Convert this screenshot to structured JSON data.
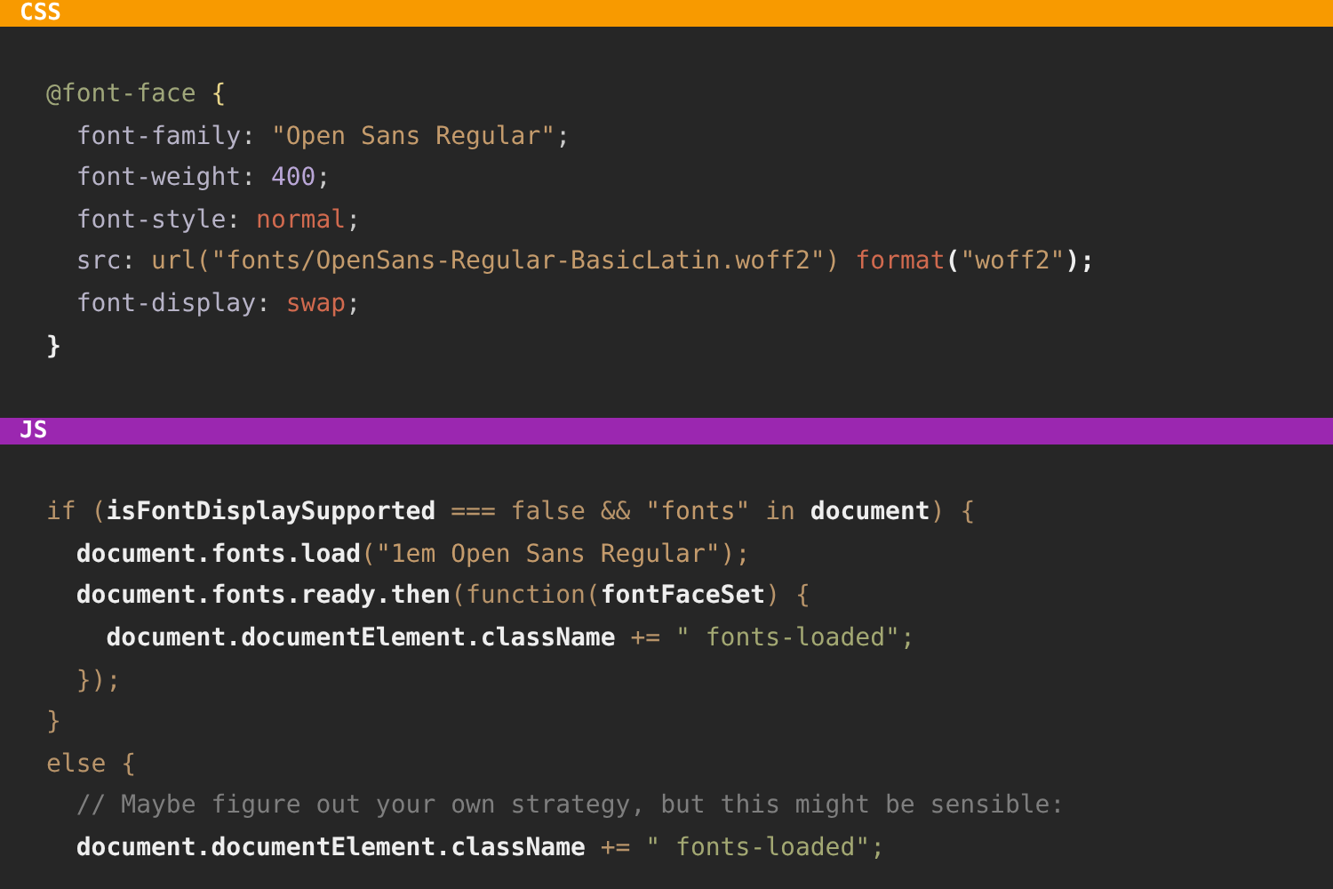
{
  "sections": [
    {
      "label": "CSS",
      "color": "#f89a00",
      "lines": [
        [
          {
            "text": "@font-face ",
            "kind": "at"
          },
          {
            "text": "{",
            "kind": "brace"
          }
        ],
        [
          {
            "text": "  font-family",
            "kind": "prop"
          },
          {
            "text": ": ",
            "kind": "plain"
          },
          {
            "text": "\"Open Sans Regular\"",
            "kind": "string"
          },
          {
            "text": ";",
            "kind": "plain"
          }
        ],
        [
          {
            "text": "  font-weight",
            "kind": "prop"
          },
          {
            "text": ": ",
            "kind": "plain"
          },
          {
            "text": "400",
            "kind": "number"
          },
          {
            "text": ";",
            "kind": "plain"
          }
        ],
        [
          {
            "text": "  font-style",
            "kind": "prop"
          },
          {
            "text": ": ",
            "kind": "plain"
          },
          {
            "text": "normal",
            "kind": "literal"
          },
          {
            "text": ";",
            "kind": "plain"
          }
        ],
        [
          {
            "text": "  src",
            "kind": "prop"
          },
          {
            "text": ": ",
            "kind": "plain"
          },
          {
            "text": "url(\"fonts/OpenSans-Regular-BasicLatin.woff2\")",
            "kind": "string"
          },
          {
            "text": " format",
            "kind": "literal"
          },
          {
            "text": "(",
            "kind": "ident"
          },
          {
            "text": "\"woff2\"",
            "kind": "string"
          },
          {
            "text": ");",
            "kind": "ident"
          }
        ],
        [
          {
            "text": "  font-display",
            "kind": "prop"
          },
          {
            "text": ": ",
            "kind": "plain"
          },
          {
            "text": "swap",
            "kind": "literal"
          },
          {
            "text": ";",
            "kind": "plain"
          }
        ],
        [
          {
            "text": "}",
            "kind": "ident"
          }
        ]
      ]
    },
    {
      "label": "JS",
      "color": "#9b27b0",
      "lines": [
        [
          {
            "text": "if (",
            "kind": "keyword"
          },
          {
            "text": "isFontDisplaySupported",
            "kind": "ident"
          },
          {
            "text": " === false && ",
            "kind": "keyword"
          },
          {
            "text": "\"fonts\"",
            "kind": "string"
          },
          {
            "text": " in ",
            "kind": "keyword"
          },
          {
            "text": "document",
            "kind": "ident"
          },
          {
            "text": ") {",
            "kind": "keyword"
          }
        ],
        [
          {
            "text": "  document.fonts.load",
            "kind": "ident"
          },
          {
            "text": "(\"1em Open Sans Regular\");",
            "kind": "string"
          }
        ],
        [
          {
            "text": "  document.fonts.ready.then",
            "kind": "ident"
          },
          {
            "text": "(function(",
            "kind": "keyword"
          },
          {
            "text": "fontFaceSet",
            "kind": "ident"
          },
          {
            "text": ") {",
            "kind": "keyword"
          }
        ],
        [
          {
            "text": "    document.documentElement.className",
            "kind": "ident"
          },
          {
            "text": " += ",
            "kind": "keyword"
          },
          {
            "text": "\" fonts-loaded\";",
            "kind": "green"
          }
        ],
        [
          {
            "text": "  });",
            "kind": "keyword"
          }
        ],
        [
          {
            "text": "}",
            "kind": "keyword"
          }
        ],
        [
          {
            "text": "else {",
            "kind": "keyword"
          }
        ],
        [
          {
            "text": "  // Maybe figure out your own strategy, but this might be sensible:",
            "kind": "comment"
          }
        ],
        [
          {
            "text": "  document.documentElement.className",
            "kind": "ident"
          },
          {
            "text": " += ",
            "kind": "keyword"
          },
          {
            "text": "\" fonts-loaded\";",
            "kind": "green"
          }
        ]
      ]
    }
  ]
}
